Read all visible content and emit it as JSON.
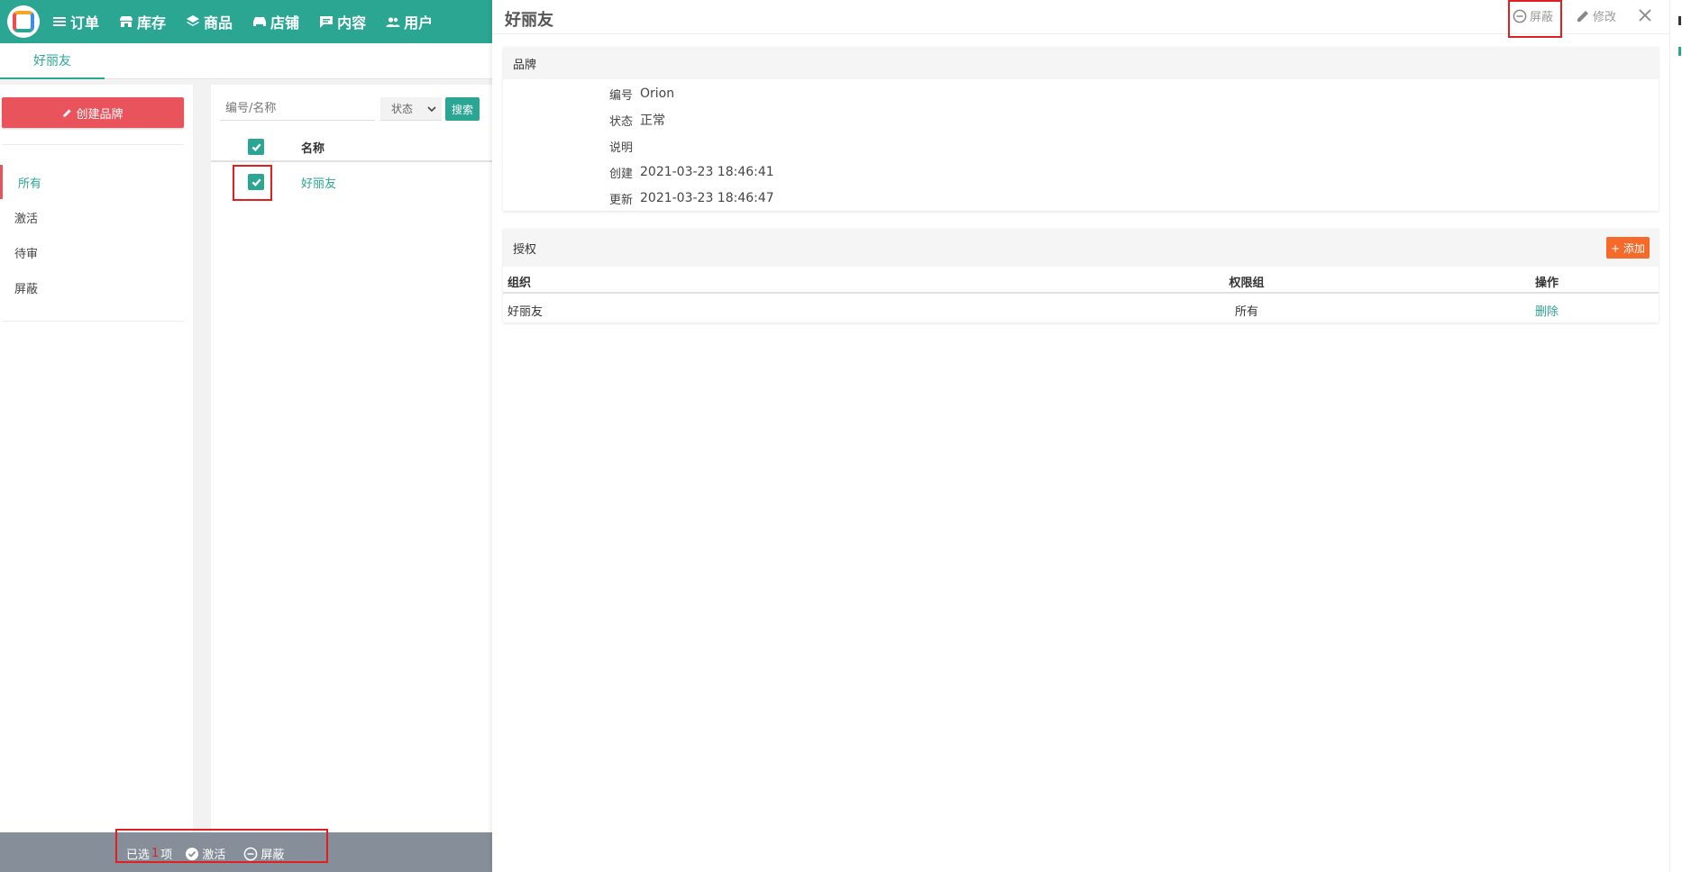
{
  "nav": {
    "items": [
      {
        "label": "订单",
        "icon": "list-icon"
      },
      {
        "label": "库存",
        "icon": "store-icon"
      },
      {
        "label": "商品",
        "icon": "layers-icon"
      },
      {
        "label": "店铺",
        "icon": "shop-icon"
      },
      {
        "label": "内容",
        "icon": "message-icon"
      },
      {
        "label": "用户",
        "icon": "users-icon"
      }
    ]
  },
  "tabs": {
    "active": "好丽友"
  },
  "left": {
    "create_label": "创建品牌",
    "statuses": [
      "所有",
      "激活",
      "待审",
      "屏蔽"
    ]
  },
  "list": {
    "search_placeholder": "编号/名称",
    "status_select": "状态",
    "search_label": "搜索",
    "header_name": "名称",
    "rows": [
      {
        "name": "好丽友",
        "checked": true
      }
    ]
  },
  "bottom": {
    "selected_prefix": "已选",
    "selected_count": "1",
    "selected_suffix": "项",
    "activate_label": "激活",
    "block_label": "屏蔽"
  },
  "detail": {
    "title": "好丽友",
    "block_label": "屏蔽",
    "edit_label": "修改",
    "brand_section": "品牌",
    "fields": [
      {
        "label": "编号",
        "value": "Orion"
      },
      {
        "label": "状态",
        "value": "正常"
      },
      {
        "label": "说明",
        "value": ""
      },
      {
        "label": "创建",
        "value": "2021-03-23 18:46:41"
      },
      {
        "label": "更新",
        "value": "2021-03-23 18:46:47"
      }
    ],
    "auth_section": "授权",
    "add_label": "+ 添加",
    "auth_columns": [
      "组织",
      "权限组",
      "操作"
    ],
    "auth_rows": [
      {
        "org": "好丽友",
        "group": "所有",
        "action": "删除"
      }
    ]
  },
  "colors": {
    "primary": "#2aa693",
    "danger": "#e8535c",
    "accent": "#f56a2a",
    "bottombar": "#868e99"
  }
}
